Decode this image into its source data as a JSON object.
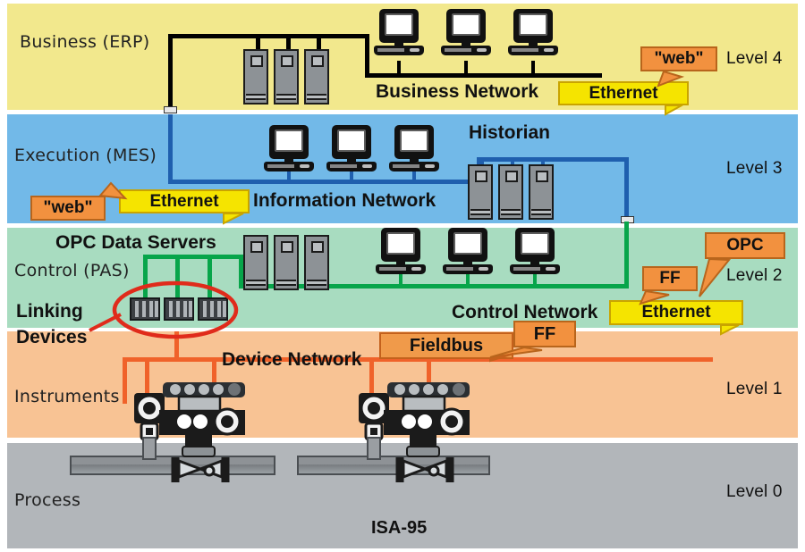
{
  "diagram": {
    "caption": "ISA-95",
    "levels": [
      {
        "key": "l4",
        "name": "Business (ERP)",
        "tag": "Level 4",
        "color": "#f2e88d"
      },
      {
        "key": "l3",
        "name": "Execution (MES)",
        "tag": "Level 3",
        "color": "#72b9e8"
      },
      {
        "key": "l2",
        "name": "Control (PAS)",
        "tag": "Level 2",
        "color": "#a8dcc0"
      },
      {
        "key": "l1",
        "name": "Instruments",
        "tag": "Level 1",
        "color": "#f8c394"
      },
      {
        "key": "l0",
        "name": "Process",
        "tag": "Level 0",
        "color": "#b2b6ba"
      }
    ],
    "networks": [
      {
        "key": "business",
        "label": "Business Network",
        "color": "#000000"
      },
      {
        "key": "information",
        "label": "Information Network",
        "color": "#1f5fae"
      },
      {
        "key": "control",
        "label": "Control Network",
        "color": "#07a54a"
      },
      {
        "key": "device",
        "label": "Device Network",
        "color": "#f0622a"
      }
    ],
    "annotations": {
      "historian": "Historian",
      "opc_data_servers": "OPC Data Servers",
      "linking_devices_line1": "Linking",
      "linking_devices_line2": "Devices"
    },
    "tags": {
      "l4_web": "\"web\"",
      "l4_ethernet": "Ethernet",
      "l3_web": "\"web\"",
      "l3_ethernet": "Ethernet",
      "l2_ff": "FF",
      "l2_opc": "OPC",
      "l2_ethernet": "Ethernet",
      "l1_fieldbus": "Fieldbus",
      "l1_ff": "FF"
    },
    "colors": {
      "ethernet_tag": "#f5e400",
      "callout_orange": "#f2913f",
      "fieldbus_orange": "#f09a4a",
      "highlight_ellipse": "#e02b1b",
      "wire_black": "#000000",
      "wire_blue": "#1f5fae",
      "wire_green": "#07a54a",
      "wire_orange": "#f0622a"
    }
  }
}
